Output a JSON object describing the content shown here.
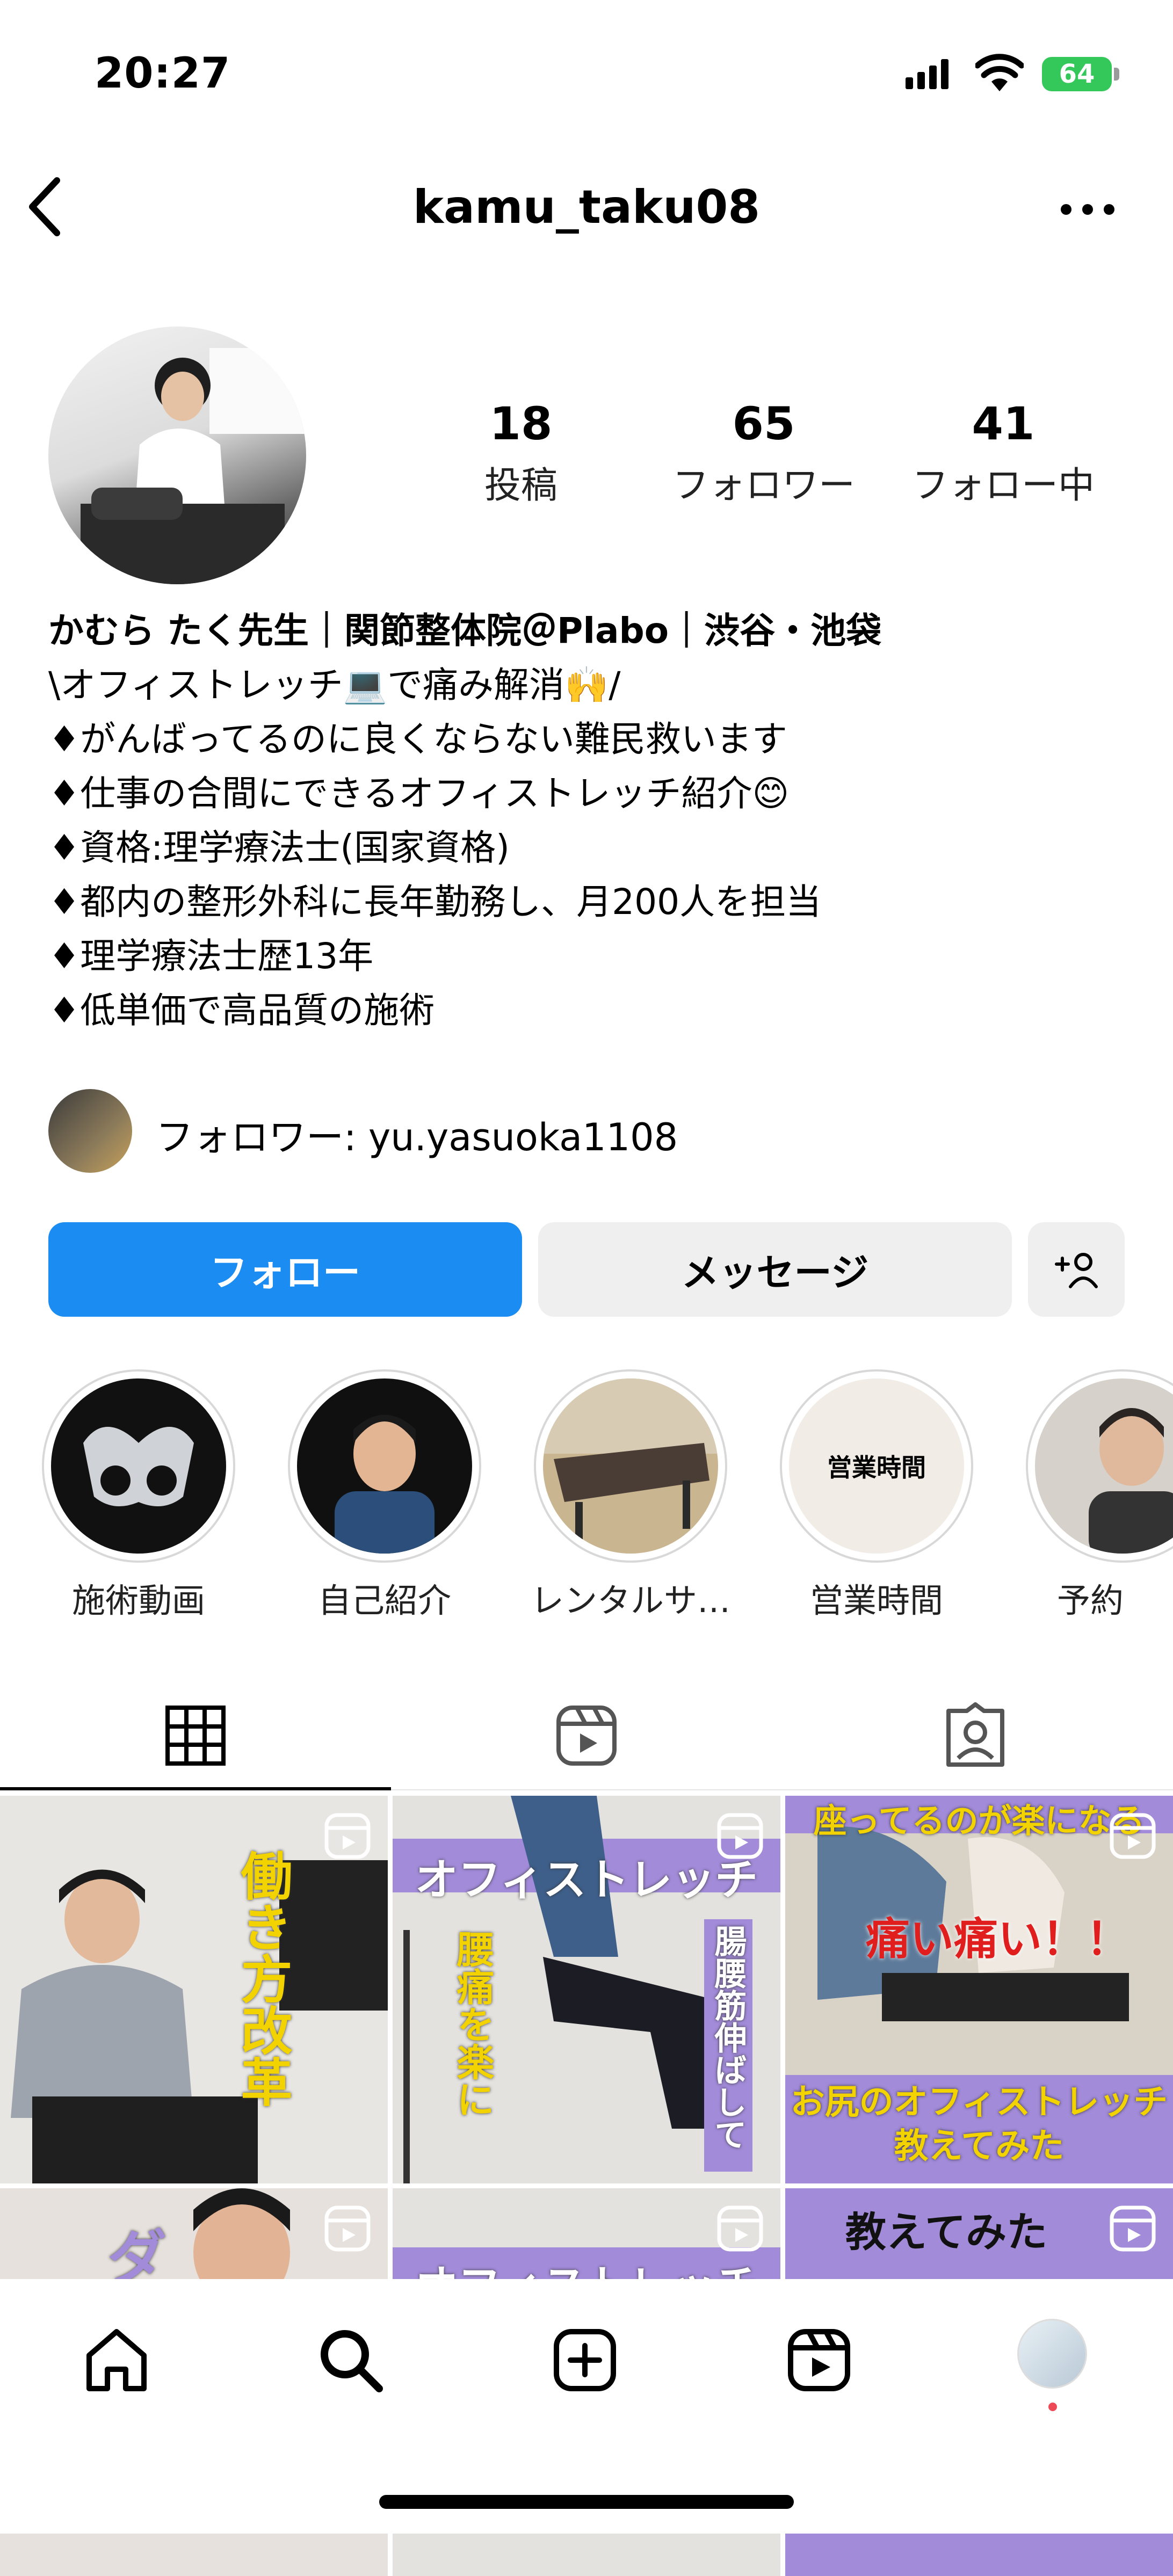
{
  "status_bar": {
    "time": "20:27",
    "battery": "64"
  },
  "header": {
    "username": "kamu_taku08"
  },
  "stats": [
    {
      "value": "18",
      "label": "投稿"
    },
    {
      "value": "65",
      "label": "フォロワー"
    },
    {
      "value": "41",
      "label": "フォロー中"
    }
  ],
  "bio": {
    "name": "かむら たく先生｜関節整体院＠Plabo｜渋谷・池袋",
    "lines": [
      "\\オフィストレッチ💻で痛み解消🙌/",
      "♦がんばってるのに良くならない難民救います",
      "♦仕事の合間にできるオフィストレッチ紹介😊",
      "♦資格:理学療法士(国家資格)",
      "♦都内の整形外科に長年勤務し、月200人を担当",
      "♦理学療法士歴13年",
      "♦低単価で高品質の施術"
    ]
  },
  "followed_by": "フォロワー: yu.yasuoka1108",
  "buttons": {
    "follow": "フォロー",
    "message": "メッセージ",
    "add_person": "+👤"
  },
  "highlights": [
    {
      "label": "施術動画"
    },
    {
      "label": "自己紹介"
    },
    {
      "label": "レンタルサ…"
    },
    {
      "label": "営業時間",
      "cover_text": "営業時間"
    },
    {
      "label": "予約"
    }
  ],
  "grid": [
    {
      "overlay": "働き方改革"
    },
    {
      "banner": "オフィストレッチ",
      "overlay_left": "腰痛を楽に",
      "overlay_right": "腸腰筋伸ばして"
    },
    {
      "top": "座ってるのが楽になる",
      "mid": "痛い痛い！！",
      "bottom1": "お尻のオフィストレッチ",
      "bottom2": "教えてみた"
    },
    {
      "overlay": "ダ"
    },
    {
      "banner": "オフィストレッチ"
    },
    {
      "banner": "教えてみた"
    }
  ],
  "colors": {
    "accent": "#1a8cf2",
    "battery": "#34c759",
    "notification_dot": "#ed4956"
  },
  "icons": {
    "nav": [
      "home-icon",
      "search-icon",
      "create-icon",
      "reels-icon",
      "profile-avatar"
    ],
    "tabs": [
      "grid-icon",
      "reels-tab-icon",
      "tagged-icon"
    ]
  }
}
